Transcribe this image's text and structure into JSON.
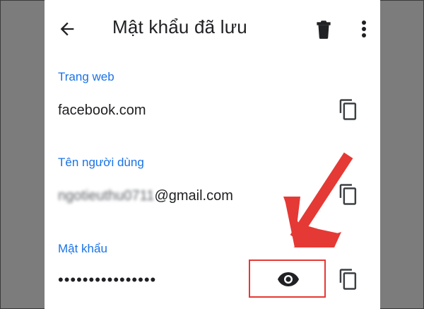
{
  "app_bar": {
    "title": "Mật khẩu đã lưu",
    "back_icon": "arrow-left-icon",
    "delete_icon": "trash-icon",
    "more_icon": "more-vertical-icon"
  },
  "fields": {
    "website": {
      "label": "Trang web",
      "value": "facebook.com"
    },
    "username": {
      "label": "Tên người dùng",
      "value_blurred": "ngotieuthu0711",
      "value_domain": "@gmail.com"
    },
    "password": {
      "label": "Mật khẩu",
      "value": "••••••••••••••••"
    }
  },
  "icons": {
    "copy": "copy-icon",
    "show_password": "eye-icon",
    "annotation_arrow": "red-arrow-icon"
  },
  "colors": {
    "accent": "#1a73e8",
    "text": "#202124",
    "annotation": "#e53935",
    "background_outer": "#7c7c7c",
    "background_inner": "#ffffff"
  }
}
